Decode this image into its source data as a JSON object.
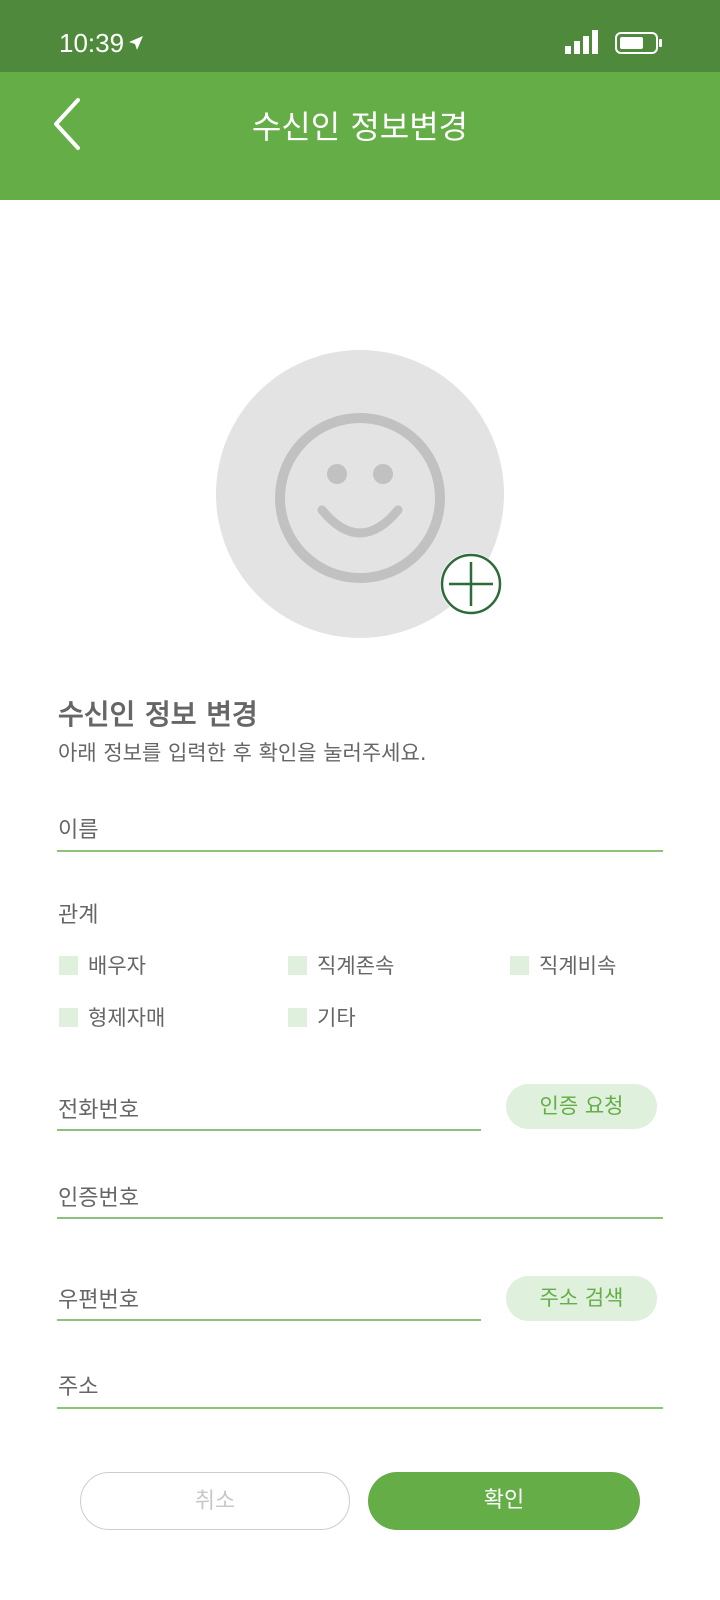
{
  "status": {
    "time": "10:39"
  },
  "header": {
    "title": "수신인 정보변경"
  },
  "section": {
    "title": "수신인 정보 변경",
    "subtitle": "아래 정보를 입력한 후 확인을 눌러주세요."
  },
  "fields": {
    "name": "이름",
    "relation": "관계",
    "phone": "전화번호",
    "auth_code": "인증번호",
    "postal": "우편번호",
    "address": "주소"
  },
  "relations": [
    "배우자",
    "직계존속",
    "직계비속",
    "형제자매",
    "기타"
  ],
  "buttons": {
    "request_auth": "인증 요청",
    "search_address": "주소 검색",
    "cancel": "취소",
    "confirm": "확인"
  },
  "colors": {
    "status_bar": "#4f8a3c",
    "primary": "#64ad47",
    "light_green": "#dff0dc"
  },
  "icons": [
    "location-arrow-icon",
    "signal-icon",
    "battery-icon",
    "back-icon",
    "smile-icon",
    "add-circle-icon"
  ]
}
